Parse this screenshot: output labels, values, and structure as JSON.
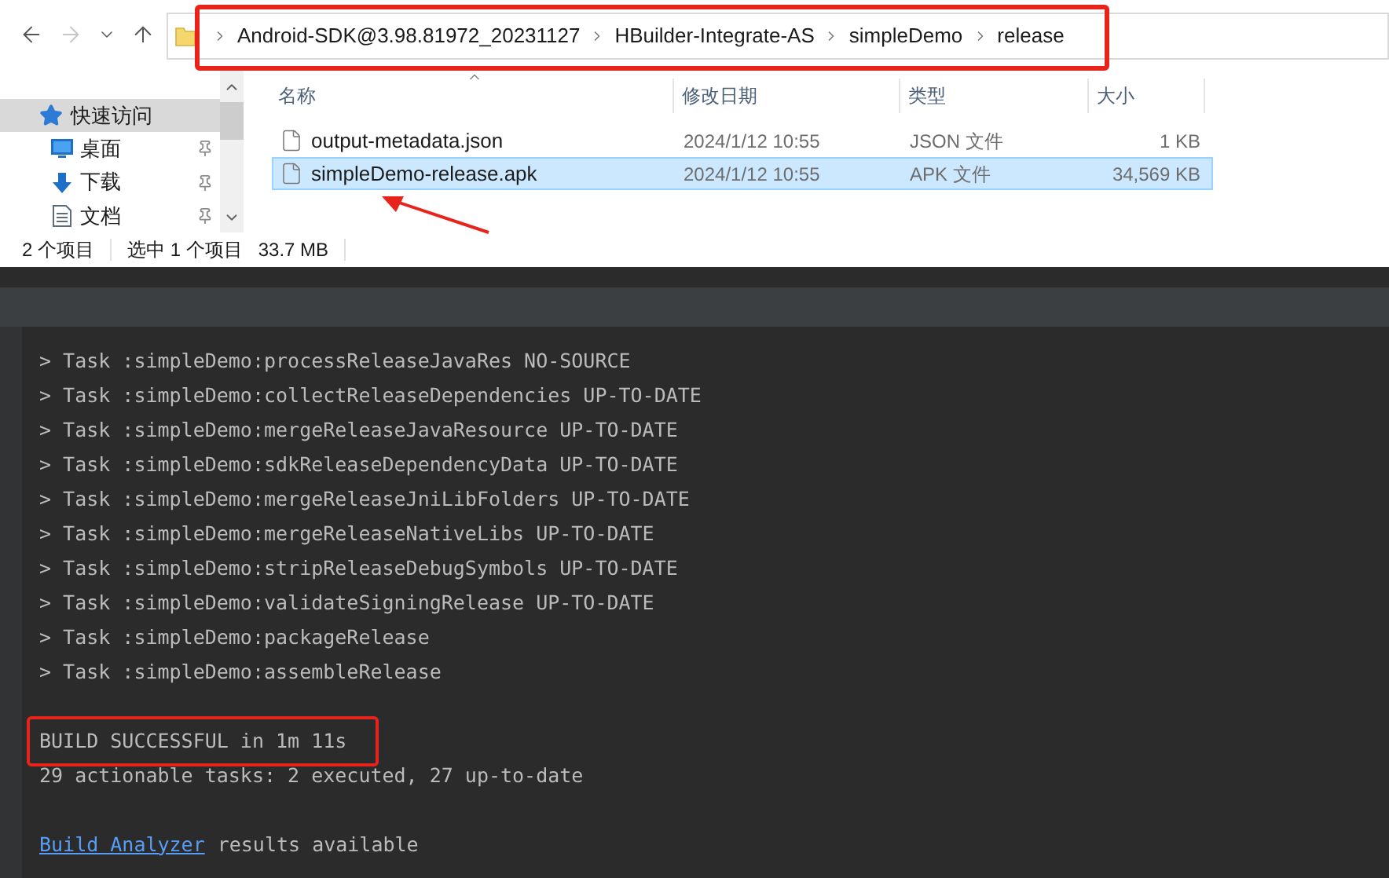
{
  "explorer": {
    "nav_buttons": [
      {
        "kind": "back",
        "disabled": false
      },
      {
        "kind": "forward",
        "disabled": true
      },
      {
        "kind": "recent",
        "disabled": false
      },
      {
        "kind": "up",
        "disabled": false
      }
    ],
    "address": {
      "highlighted": true,
      "path": [
        "Android-SDK@3.98.81972_20231127",
        "HBuilder-Integrate-AS",
        "simpleDemo",
        "release"
      ]
    },
    "sidebar": {
      "items": [
        {
          "label": "快速访问",
          "kind": "star",
          "selected": true,
          "pinned": false
        },
        {
          "label": "桌面",
          "kind": "desktop",
          "selected": false,
          "pinned": true
        },
        {
          "label": "下载",
          "kind": "download",
          "selected": false,
          "pinned": true
        },
        {
          "label": "文档",
          "kind": "document",
          "selected": false,
          "pinned": true
        }
      ]
    },
    "columns": [
      "名称",
      "修改日期",
      "类型",
      "大小"
    ],
    "files": [
      {
        "name": "output-metadata.json",
        "modified": "2024/1/12 10:55",
        "type": "JSON 文件",
        "size": "1 KB",
        "selected": false
      },
      {
        "name": "simpleDemo-release.apk",
        "modified": "2024/1/12 10:55",
        "type": "APK 文件",
        "size": "34,569 KB",
        "selected": true,
        "pointed_at": true
      }
    ],
    "status": {
      "count": "2 个项目",
      "selection": "选中 1 个项目",
      "size": "33.7 MB"
    }
  },
  "console": {
    "lines": [
      {
        "kind": "task",
        "text": "> Task :simpleDemo:processReleaseJavaRes NO-SOURCE"
      },
      {
        "kind": "task",
        "text": "> Task :simpleDemo:collectReleaseDependencies UP-TO-DATE"
      },
      {
        "kind": "task",
        "text": "> Task :simpleDemo:mergeReleaseJavaResource UP-TO-DATE"
      },
      {
        "kind": "task",
        "text": "> Task :simpleDemo:sdkReleaseDependencyData UP-TO-DATE"
      },
      {
        "kind": "task",
        "text": "> Task :simpleDemo:mergeReleaseJniLibFolders UP-TO-DATE"
      },
      {
        "kind": "task",
        "text": "> Task :simpleDemo:mergeReleaseNativeLibs UP-TO-DATE"
      },
      {
        "kind": "task",
        "text": "> Task :simpleDemo:stripReleaseDebugSymbols UP-TO-DATE"
      },
      {
        "kind": "task",
        "text": "> Task :simpleDemo:validateSigningRelease UP-TO-DATE"
      },
      {
        "kind": "task",
        "text": "> Task :simpleDemo:packageRelease"
      },
      {
        "kind": "task",
        "text": "> Task :simpleDemo:assembleRelease"
      },
      {
        "kind": "gap"
      },
      {
        "kind": "result",
        "text": "BUILD SUCCESSFUL in 1m 11s",
        "highlighted": true
      },
      {
        "kind": "task",
        "text": "29 actionable tasks: 2 executed, 27 up-to-date"
      },
      {
        "kind": "gap"
      },
      {
        "kind": "link",
        "link": "Build Analyzer",
        "text": "results available"
      }
    ]
  }
}
